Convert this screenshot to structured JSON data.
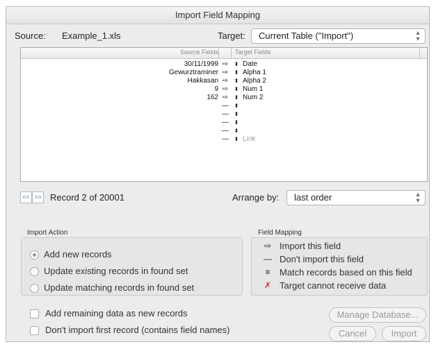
{
  "window": {
    "title": "Import Field Mapping"
  },
  "source": {
    "label": "Source:",
    "value": "Example_1.xls"
  },
  "target": {
    "label": "Target:",
    "value": "Current Table (\"Import\")"
  },
  "table": {
    "headers": {
      "source": "Source Fields",
      "target": "Target Fields"
    },
    "rows": [
      {
        "source": "30/11/1999",
        "arrow": "⇨",
        "target": "Date"
      },
      {
        "source": "Gewurztraminer",
        "arrow": "⇨",
        "target": "Alpha 1"
      },
      {
        "source": "Hakkasan",
        "arrow": "⇨",
        "target": "Alpha 2"
      },
      {
        "source": "9",
        "arrow": "⇨",
        "target": "Num 1"
      },
      {
        "source": "162",
        "arrow": "⇨",
        "target": "Num 2"
      },
      {
        "source": "",
        "arrow": "—",
        "target": ""
      },
      {
        "source": "",
        "arrow": "—",
        "target": ""
      },
      {
        "source": "",
        "arrow": "—",
        "target": ""
      },
      {
        "source": "",
        "arrow": "—",
        "target": ""
      },
      {
        "source": "",
        "arrow": "—",
        "target": "Link"
      }
    ]
  },
  "nav": {
    "prev": "<<",
    "next": ">>",
    "record_text": "Record 2 of 20001"
  },
  "arrange": {
    "label": "Arrange by:",
    "value": "last order"
  },
  "import_action": {
    "title": "Import Action",
    "options": [
      {
        "label": "Add new records",
        "selected": true
      },
      {
        "label": "Update existing records in found set",
        "selected": false
      },
      {
        "label": "Update matching records in found set",
        "selected": false
      }
    ]
  },
  "field_mapping": {
    "title": "Field Mapping",
    "items": [
      {
        "symbol": "⇨",
        "label": "Import this field"
      },
      {
        "symbol": "—",
        "label": "Don't import this field"
      },
      {
        "symbol": "≡",
        "label": "Match records based on this field"
      },
      {
        "symbol": "✗",
        "label": "Target cannot receive data",
        "color": "#d42a2a"
      }
    ]
  },
  "options": {
    "add_remaining": "Add remaining data as new records",
    "dont_import_first": "Don't import first record (contains field names)"
  },
  "buttons": {
    "manage": "Manage Database...",
    "cancel": "Cancel",
    "import": "Import"
  }
}
